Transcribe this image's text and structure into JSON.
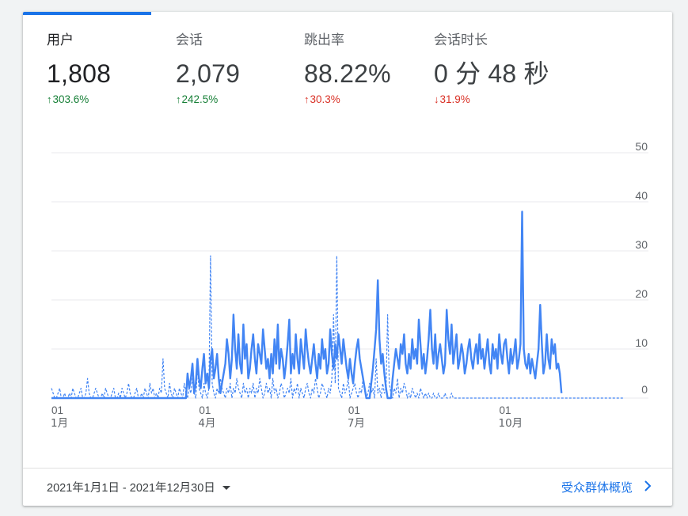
{
  "metrics": [
    {
      "label": "用户",
      "value": "1,808",
      "change": "303.6%",
      "direction": "up",
      "tone": "good"
    },
    {
      "label": "会话",
      "value": "2,079",
      "change": "242.5%",
      "direction": "up",
      "tone": "good"
    },
    {
      "label": "跳出率",
      "value": "88.22%",
      "change": "30.3%",
      "direction": "up",
      "tone": "bad"
    },
    {
      "label": "会话时长",
      "value": "0 分 48 秒",
      "change": "31.9%",
      "direction": "down",
      "tone": "bad"
    }
  ],
  "footer": {
    "date_range": "2021年1月1日 - 2021年12月30日",
    "link_label": "受众群体概览"
  },
  "colors": {
    "accent": "#1a73e8",
    "series": "#4285f4",
    "positive": "#188038",
    "negative": "#d93025"
  },
  "chart_data": {
    "type": "line",
    "y_ticks": [
      "50",
      "40",
      "30",
      "20",
      "10",
      "0"
    ],
    "ylim": [
      0,
      50
    ],
    "x_ticks": [
      {
        "day": "01",
        "month": "1月"
      },
      {
        "day": "01",
        "month": "4月"
      },
      {
        "day": "01",
        "month": "7月"
      },
      {
        "day": "01",
        "month": "10月"
      }
    ],
    "grid": true,
    "series": [
      {
        "style": "solid",
        "values": [
          0,
          0,
          0,
          0,
          0,
          0,
          0,
          0,
          0,
          0,
          0,
          0,
          0,
          0,
          0,
          0,
          0,
          0,
          0,
          0,
          0,
          0,
          0,
          0,
          0,
          0,
          0,
          0,
          0,
          0,
          0,
          0,
          0,
          0,
          0,
          0,
          0,
          0,
          0,
          0,
          0,
          0,
          0,
          0,
          0,
          0,
          0,
          0,
          0,
          0,
          0,
          0,
          0,
          0,
          0,
          0,
          0,
          0,
          0,
          0,
          0,
          0,
          0,
          0,
          0,
          0,
          0,
          0,
          0,
          0,
          0,
          0,
          0,
          0,
          0,
          0,
          0,
          0,
          0,
          0,
          0,
          0,
          0,
          5,
          2,
          4,
          7,
          1,
          3,
          8,
          4,
          2,
          6,
          9,
          3,
          5,
          2,
          8,
          10,
          4,
          6,
          9,
          4,
          1,
          3,
          5,
          7,
          12,
          9,
          4,
          8,
          17,
          10,
          6,
          13,
          7,
          5,
          15,
          8,
          11,
          4,
          6,
          10,
          13,
          8,
          5,
          11,
          9,
          7,
          14,
          10,
          6,
          8,
          4,
          9,
          5,
          12,
          7,
          15,
          6,
          10,
          8,
          4,
          7,
          11,
          16,
          5,
          9,
          6,
          13,
          8,
          5,
          12,
          9,
          6,
          14,
          10,
          7,
          5,
          8,
          11,
          7,
          4,
          9,
          6,
          12,
          8,
          10,
          5,
          7,
          14,
          9,
          6,
          11,
          8,
          13,
          10,
          7,
          12,
          9,
          6,
          4,
          8,
          5,
          3,
          7,
          10,
          12,
          8,
          6,
          4,
          2,
          0,
          0,
          0,
          3,
          6,
          10,
          14,
          24,
          12,
          7,
          9,
          5,
          2,
          0,
          0,
          0,
          4,
          7,
          10,
          8,
          6,
          11,
          9,
          13,
          7,
          5,
          9,
          6,
          12,
          8,
          10,
          7,
          16,
          11,
          6,
          9,
          5,
          8,
          12,
          18,
          10,
          7,
          13,
          6,
          9,
          11,
          8,
          5,
          7,
          18,
          12,
          9,
          15,
          7,
          10,
          13,
          6,
          8,
          11,
          9,
          5,
          7,
          10,
          12,
          8,
          6,
          9,
          11,
          7,
          13,
          8,
          10,
          6,
          9,
          12,
          7,
          5,
          11,
          8,
          10,
          6,
          13,
          9,
          7,
          11,
          12,
          8,
          5,
          10,
          7,
          9,
          12,
          6,
          8,
          11,
          38,
          10,
          7,
          6,
          9,
          5,
          8,
          6,
          4,
          7,
          10,
          19,
          11,
          5,
          7,
          13,
          8,
          6,
          12,
          9,
          11,
          6,
          7,
          5,
          1
        ],
        "start_day": 0
      },
      {
        "style": "dashed",
        "values": [
          2,
          1,
          0,
          0,
          1,
          2,
          0,
          0,
          1,
          0,
          0,
          1,
          0,
          2,
          1,
          0,
          0,
          1,
          2,
          0,
          0,
          1,
          4,
          1,
          0,
          0,
          1,
          2,
          1,
          0,
          0,
          1,
          0,
          2,
          1,
          0,
          0,
          1,
          2,
          0,
          0,
          1,
          0,
          2,
          1,
          0,
          1,
          3,
          1,
          0,
          0,
          1,
          2,
          0,
          0,
          1,
          0,
          2,
          1,
          0,
          3,
          1,
          2,
          0,
          1,
          0,
          2,
          1,
          8,
          2,
          1,
          0,
          3,
          1,
          0,
          2,
          1,
          0,
          2,
          1,
          0,
          3,
          1,
          0,
          2,
          1,
          4,
          1,
          0,
          6,
          2,
          1,
          0,
          3,
          1,
          0,
          2,
          29,
          3,
          1,
          0,
          2,
          1,
          4,
          2,
          1,
          0,
          2,
          1,
          3,
          0,
          2,
          1,
          4,
          2,
          1,
          0,
          3,
          1,
          2,
          0,
          2,
          1,
          3,
          0,
          2,
          1,
          4,
          2,
          0,
          1,
          3,
          1,
          2,
          0,
          4,
          1,
          2,
          0,
          1,
          3,
          2,
          0,
          1,
          2,
          1,
          4,
          0,
          2,
          1,
          3,
          0,
          2,
          1,
          0,
          2,
          3,
          1,
          0,
          2,
          1,
          4,
          2,
          0,
          1,
          3,
          2,
          1,
          0,
          2,
          1,
          4,
          17,
          3,
          29,
          2,
          1,
          0,
          3,
          1,
          2,
          4,
          0,
          1,
          2,
          3,
          1,
          0,
          2,
          1,
          4,
          2,
          0,
          1,
          3,
          1,
          2,
          0,
          8,
          1,
          2,
          0,
          3,
          1,
          2,
          17,
          3,
          1,
          0,
          2,
          1,
          4,
          0,
          2,
          1,
          3,
          2,
          0,
          1,
          0,
          2,
          1,
          0,
          1,
          0,
          2,
          1,
          0,
          1,
          0,
          1,
          0,
          0,
          1,
          0,
          0,
          1,
          0,
          0,
          0,
          1,
          0,
          0,
          0,
          1,
          0,
          0,
          0,
          0,
          0,
          0,
          0,
          0,
          0,
          0,
          0,
          0,
          0,
          0,
          0,
          0,
          0,
          0,
          0,
          0,
          0,
          0,
          0,
          0,
          0,
          0,
          0,
          0,
          0,
          0,
          0,
          0,
          0,
          0,
          0,
          0,
          0,
          0,
          0,
          0,
          0,
          0,
          0,
          0,
          0,
          0,
          0,
          0,
          0,
          0,
          0,
          0,
          0,
          0,
          0,
          0,
          0,
          0,
          0,
          0,
          0,
          0,
          0,
          0,
          0,
          0,
          0,
          0,
          0,
          0,
          0,
          0,
          0,
          0,
          0,
          0,
          0,
          0,
          0,
          0,
          0,
          0,
          0,
          0,
          0,
          0,
          0,
          0,
          0,
          0,
          0,
          0,
          0,
          0,
          0,
          0,
          0,
          0,
          0,
          0,
          0,
          0,
          0,
          0,
          0
        ],
        "start_day": 0
      }
    ]
  }
}
